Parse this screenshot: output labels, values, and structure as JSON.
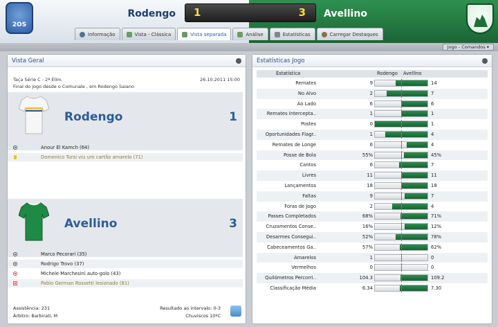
{
  "header": {
    "home_team": "Rodengo",
    "away_team": "Avellino",
    "home_score": "1",
    "away_score": "3",
    "home_logo_text": "2OS"
  },
  "tabs": [
    {
      "label": "Informação",
      "icon": "info-icon"
    },
    {
      "label": "Vista - Clássica",
      "icon": "pitch-icon"
    },
    {
      "label": "Vista separada",
      "icon": "pitch-icon"
    },
    {
      "label": "Análise",
      "icon": "pitch-icon"
    },
    {
      "label": "Estatísticas",
      "icon": "chart-icon"
    },
    {
      "label": "Carregar Destaques",
      "icon": "star-icon"
    }
  ],
  "toolbar": {
    "menu_label": "Jogo - Comandos"
  },
  "overview": {
    "title": "Vista Geral",
    "competition": "Taça Série C - 2ª Elim.",
    "date": "26.10.2011 15:00",
    "venue": "Final do jogo desde o Comunale , em Rodengo Saiano",
    "home": {
      "name": "Rodengo",
      "score": "1",
      "events": [
        {
          "icon": "ball-icon",
          "text": "Anour El Kamch (64)"
        },
        {
          "icon": "yellow-card-icon",
          "text": "Domenico Tursi viu um cartão amarelo (71)"
        }
      ]
    },
    "away": {
      "name": "Avellino",
      "score": "3",
      "events": [
        {
          "icon": "ball-icon",
          "text": "Marco Pecorari (35)"
        },
        {
          "icon": "ball-icon",
          "text": "Rodrigo Trovo (37)"
        },
        {
          "icon": "own-goal-icon",
          "text": "Michele Marchesini auto-golo (43)"
        },
        {
          "icon": "injury-icon",
          "text": "Pablo German Rossetti lesionado (81)"
        }
      ]
    },
    "attendance": "Assistência: 231",
    "referee": "Árbitro: Barbirati, M",
    "halftime": "Resultado ao intervalo: 0-3",
    "weather": "Chuviscos 10ºC"
  },
  "stats": {
    "title": "Estatísticas Jogo",
    "col_stat": "Estatística",
    "col_home": "Rodengo",
    "col_away": "Avellino",
    "rows": [
      {
        "label": "Remates",
        "home": "9",
        "away": "14",
        "away_frac": 0.61
      },
      {
        "label": "No Alvo",
        "home": "2",
        "away": "7",
        "away_frac": 0.78
      },
      {
        "label": "Ao Lado",
        "home": "6",
        "away": "6",
        "away_frac": 0.5
      },
      {
        "label": "Remates Intercepta..",
        "home": "1",
        "away": "1",
        "away_frac": 0.5
      },
      {
        "label": "Postes",
        "home": "0",
        "away": "1",
        "away_frac": 1.0
      },
      {
        "label": "Oportunidades Flagr..",
        "home": "1",
        "away": "4",
        "away_frac": 0.8
      },
      {
        "label": "Remates de Longe",
        "home": "6",
        "away": "4",
        "away_frac": 0.4
      },
      {
        "label": "Posse de Bola",
        "home": "55%",
        "away": "45%",
        "away_frac": 0.45
      },
      {
        "label": "Cantos",
        "home": "6",
        "away": "7",
        "away_frac": 0.54
      },
      {
        "label": "Livres",
        "home": "11",
        "away": "11",
        "away_frac": 0.5
      },
      {
        "label": "Lançamentos",
        "home": "18",
        "away": "18",
        "away_frac": 0.5
      },
      {
        "label": "Faltas",
        "home": "9",
        "away": "7",
        "away_frac": 0.44
      },
      {
        "label": "Foras de Jogo",
        "home": "2",
        "away": "4",
        "away_frac": 0.67
      },
      {
        "label": "Passes Completados",
        "home": "68%",
        "away": "71%",
        "away_frac": 0.51
      },
      {
        "label": "Cruzamentos Conse..",
        "home": "16%",
        "away": "12%",
        "away_frac": 0.43
      },
      {
        "label": "Desarmes Consegui..",
        "home": "52%",
        "away": "78%",
        "away_frac": 0.6
      },
      {
        "label": "Cabeceamentos Ga..",
        "home": "57%",
        "away": "62%",
        "away_frac": 0.52
      },
      {
        "label": "Amarelos",
        "home": "1",
        "away": "0",
        "away_frac": 0.0
      },
      {
        "label": "Vermelhos",
        "home": "0",
        "away": "0",
        "away_frac": 0.0
      },
      {
        "label": "Quilómetros Percorri..",
        "home": "104.3",
        "away": "109.2",
        "away_frac": 0.51
      },
      {
        "label": "Classificação Média",
        "home": "6.34",
        "away": "7.30",
        "away_frac": 0.53
      }
    ]
  },
  "colors": {
    "accent_green": "#1f6e39",
    "accent_blue": "#2d5c96",
    "score_yellow": "#f4e13b"
  }
}
